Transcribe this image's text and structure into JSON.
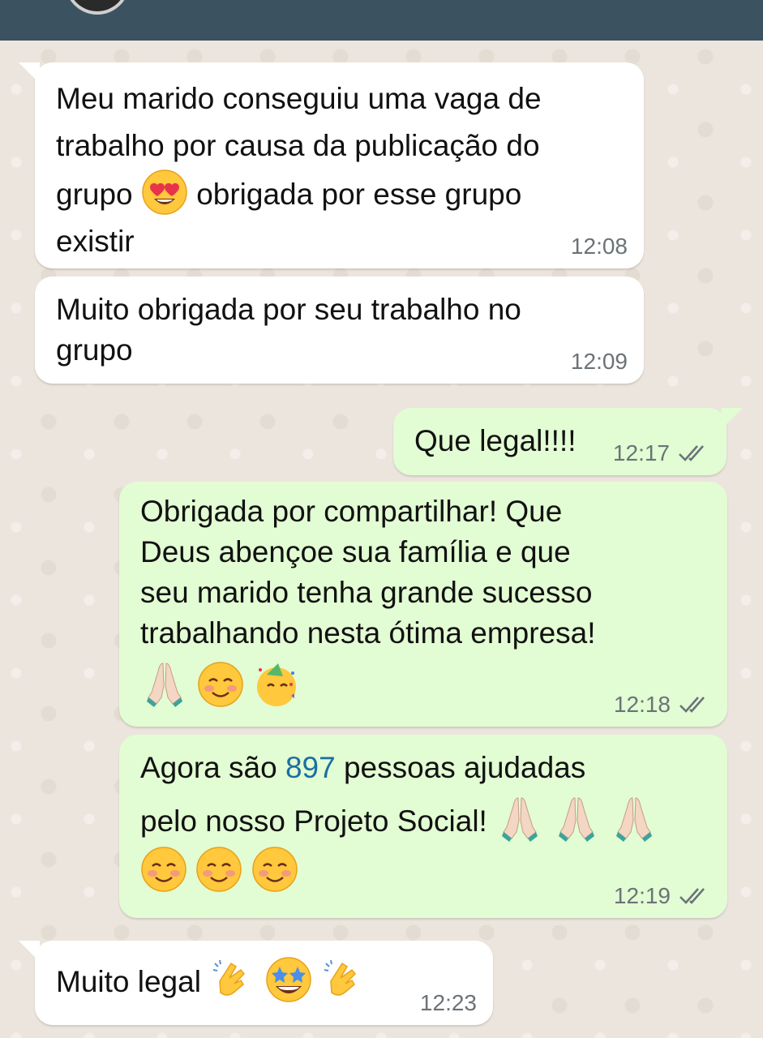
{
  "messages": [
    {
      "direction": "incoming",
      "lines": [
        "Meu marido conseguiu uma vaga de",
        "trabalho por causa da publicação do",
        "grupo",
        "obrigada por esse grupo",
        "existir"
      ],
      "time": "12:08",
      "emojis": [
        "heart-eyes-emoji"
      ]
    },
    {
      "direction": "incoming",
      "lines": [
        "Muito obrigada por seu trabalho no",
        "grupo"
      ],
      "time": "12:09"
    },
    {
      "direction": "outgoing",
      "lines": [
        "Que legal!!!!"
      ],
      "time": "12:17",
      "status": "read-double-check"
    },
    {
      "direction": "outgoing",
      "lines": [
        "Obrigada por compartilhar! Que",
        "Deus abençoe sua família e que",
        "seu marido tenha grande sucesso",
        "trabalhando nesta ótima empresa!"
      ],
      "time": "12:18",
      "status": "read-double-check",
      "emojis": [
        "folded-hands-emoji",
        "smiling-blush-emoji",
        "party-face-emoji"
      ]
    },
    {
      "direction": "outgoing",
      "lines": [
        "Agora são",
        "897",
        "pessoas ajudadas",
        "pelo nosso Projeto Social!"
      ],
      "time": "12:19",
      "status": "read-double-check",
      "emojis": [
        "folded-hands-emoji",
        "folded-hands-emoji",
        "folded-hands-emoji",
        "smiling-blush-emoji",
        "smiling-blush-emoji",
        "smiling-blush-emoji"
      ]
    },
    {
      "direction": "incoming",
      "lines": [
        "Muito legal"
      ],
      "time": "12:23",
      "emojis": [
        "clapping-hands-emoji",
        "star-struck-emoji",
        "clapping-hands-emoji"
      ]
    }
  ],
  "colors": {
    "header": "#3b5261",
    "wallpaper": "#ece5dd",
    "incoming_bubble": "#ffffff",
    "outgoing_bubble": "#e2fcd3",
    "read_ticks": "#6b7378",
    "number_highlight": "#1b6fa1"
  }
}
